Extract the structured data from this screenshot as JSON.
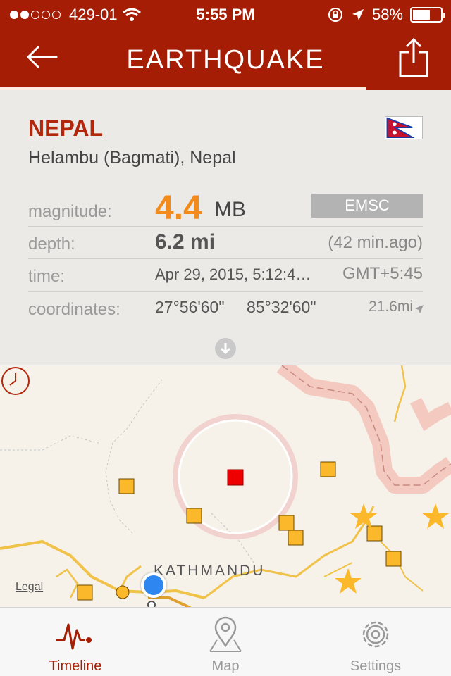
{
  "status_bar": {
    "carrier": "429-01",
    "time": "5:55 PM",
    "battery": "58%",
    "signal_bars_filled": 2,
    "signal_bars_total": 5
  },
  "header": {
    "title": "EARTHQUAKE",
    "back_icon": "back-arrow-icon",
    "share_icon": "share-icon"
  },
  "event": {
    "country": "NEPAL",
    "location": "Helambu (Bagmati), Nepal",
    "magnitude_label": "magnitude:",
    "magnitude_value": "4.4",
    "magnitude_unit": "MB",
    "source": "EMSC",
    "depth_label": "depth:",
    "depth_value": "6.2 mi",
    "ago": "(42 min.ago)",
    "time_label": "time:",
    "time_value": "Apr 29, 2015, 5:12:4…",
    "timezone": "GMT+5:45",
    "coordinates_label": "coordinates:",
    "latitude": "27°56'60\"",
    "longitude": "85°32'60\"",
    "distance": "21.6mi"
  },
  "map": {
    "legal": "Legal",
    "city_label": "KATHMANDU"
  },
  "tabs": [
    {
      "label": "Timeline",
      "icon": "timeline-pulse-icon",
      "active": true
    },
    {
      "label": "Map",
      "icon": "map-pin-icon",
      "active": false
    },
    {
      "label": "Settings",
      "icon": "gear-icon",
      "active": false
    }
  ],
  "colors": {
    "brand": "#a51d04",
    "magnitude": "#f28b1c",
    "epicenter": "#ee0000",
    "quake_marker": "#fbb82a"
  }
}
